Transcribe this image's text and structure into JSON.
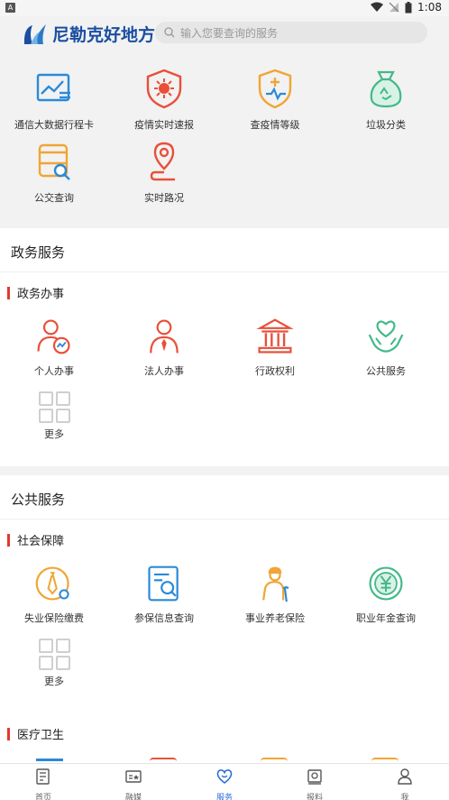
{
  "status_bar": {
    "time": "1:08",
    "badge": "A"
  },
  "header": {
    "app_name": "尼勒克好地方",
    "search_placeholder": "输入您要查询的服务"
  },
  "top_services": [
    {
      "label": "通信大数据行程卡",
      "icon": "chart-screen-icon"
    },
    {
      "label": "疫情实时速报",
      "icon": "virus-shield-icon"
    },
    {
      "label": "查疫情等级",
      "icon": "medical-shield-icon"
    },
    {
      "label": "垃圾分类",
      "icon": "recycle-bag-icon"
    },
    {
      "label": "公交查询",
      "icon": "bus-search-icon"
    },
    {
      "label": "实时路况",
      "icon": "location-route-icon"
    }
  ],
  "gov_section": {
    "title": "政务服务",
    "sub_title": "政务办事",
    "items": [
      {
        "label": "个人办事",
        "icon": "person-chart-icon"
      },
      {
        "label": "法人办事",
        "icon": "person-tie-icon"
      },
      {
        "label": "行政权利",
        "icon": "government-building-icon"
      },
      {
        "label": "公共服务",
        "icon": "heart-hands-icon"
      }
    ],
    "more_label": "更多"
  },
  "public_section": {
    "title": "公共服务",
    "sub_title": "社会保障",
    "items": [
      {
        "label": "失业保险缴费",
        "icon": "tie-circle-icon"
      },
      {
        "label": "参保信息查询",
        "icon": "document-search-icon"
      },
      {
        "label": "事业养老保险",
        "icon": "elderly-person-icon"
      },
      {
        "label": "职业年金查询",
        "icon": "yuan-coin-icon"
      }
    ],
    "more_label": "更多",
    "sub_title_2": "医疗卫生"
  },
  "tabbar": {
    "items": [
      {
        "label": "首页",
        "icon": "home-doc-icon",
        "active": false
      },
      {
        "label": "融媒",
        "icon": "media-icon",
        "active": false
      },
      {
        "label": "服务",
        "icon": "service-heart-icon",
        "active": true
      },
      {
        "label": "报料",
        "icon": "report-icon",
        "active": false
      },
      {
        "label": "我",
        "icon": "user-icon",
        "active": false
      }
    ]
  },
  "colors": {
    "brand": "#1b4ea0",
    "red": "#e8503a",
    "orange": "#f0a534",
    "blue": "#2a8ad8",
    "green": "#43b98a",
    "accent_bar": "#e03a2f",
    "tab_active": "#2a6fd8"
  }
}
